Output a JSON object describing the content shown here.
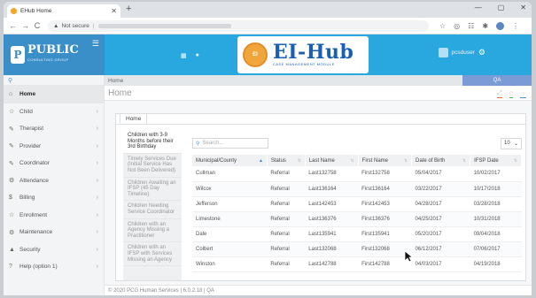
{
  "browser": {
    "tab_title": "EHub Home",
    "close_glyph": "✕",
    "new_tab_glyph": "+",
    "security": "Not secure",
    "window_controls": [
      "—",
      "▢",
      "✕"
    ],
    "back": "←",
    "forward": "→",
    "reload": "C"
  },
  "brand": {
    "name": "PUBLIC",
    "subtitle": "CONSULTING GROUP",
    "logo_letter": "P"
  },
  "topbar": {
    "logo_title": "EI-Hub",
    "logo_subtitle": "CASE MANAGEMENT MODULE",
    "user_name": "pcsduser"
  },
  "sidebar": {
    "items": [
      {
        "label": "Home",
        "icon": "home-icon",
        "glyph": "⌂",
        "active": true
      },
      {
        "label": "Child",
        "icon": "star-icon",
        "glyph": "☆"
      },
      {
        "label": "Therapist",
        "icon": "edit-icon",
        "glyph": "✎"
      },
      {
        "label": "Provider",
        "icon": "edit-icon",
        "glyph": "✎"
      },
      {
        "label": "Coordinator",
        "icon": "edit-icon",
        "glyph": "✎"
      },
      {
        "label": "Attendance",
        "icon": "gear-icon",
        "glyph": "⚙"
      },
      {
        "label": "Billing",
        "icon": "dollar-icon",
        "glyph": "$"
      },
      {
        "label": "Enrollment",
        "icon": "star-icon",
        "glyph": "☆"
      },
      {
        "label": "Maintenance",
        "icon": "gears-icon",
        "glyph": "⚙"
      },
      {
        "label": "Security",
        "icon": "lock-icon",
        "glyph": "▲"
      },
      {
        "label": "Help (option 1)",
        "icon": "question-icon",
        "glyph": "?"
      }
    ]
  },
  "breadcrumb": "Home",
  "env_badge": "QA",
  "page_title": "Home",
  "panel_tab": "Home",
  "left_tabs": [
    {
      "label": "Children with 3-9 Months before their 3rd Birthday",
      "active": true
    },
    {
      "label": "Timely Services Due (Initial Service Has Not Been Delivered)"
    },
    {
      "label": "Children Awaiting an IFSP (45 Day Timeline)"
    },
    {
      "label": "Children Needing Service Coordinator"
    },
    {
      "label": "Children with an Agency Missing a Practitioner"
    },
    {
      "label": "Children with an IFSP with Services Missing an Agency"
    }
  ],
  "grid": {
    "search_placeholder": "Search...",
    "page_size": "10",
    "columns": [
      "Municipal/County",
      "Status",
      "Last Name",
      "First Name",
      "Date of Birth",
      "IFSP Date"
    ],
    "rows": [
      [
        "Cullman",
        "Referral",
        "Last132758",
        "First132758",
        "05/04/2017",
        "10/02/2017"
      ],
      [
        "Wilcox",
        "Referral",
        "Last136164",
        "First136164",
        "03/22/2017",
        "10/17/2018"
      ],
      [
        "Jefferson",
        "Referral",
        "Last142453",
        "First142453",
        "04/28/2017",
        "03/28/2018"
      ],
      [
        "Limestone",
        "Referral",
        "Last136376",
        "First136376",
        "04/25/2017",
        "10/31/2018"
      ],
      [
        "Dale",
        "Referral",
        "Last135941",
        "First135941",
        "05/20/2017",
        "09/04/2018"
      ],
      [
        "Colbert",
        "Referral",
        "Last132068",
        "First132068",
        "06/12/2017",
        "07/06/2017"
      ],
      [
        "Winston",
        "Referral",
        "Last142788",
        "First142788",
        "04/03/2017",
        "04/19/2018"
      ]
    ]
  },
  "footer": "© 2020 PCG Human Services | 6.0.2.18 | QA",
  "colors": {
    "brand_blue": "#3b8fc9",
    "topbar_blue": "#29a8e0",
    "qa_badge": "#7b9bd6",
    "logo_orange": "#f0a63a"
  }
}
